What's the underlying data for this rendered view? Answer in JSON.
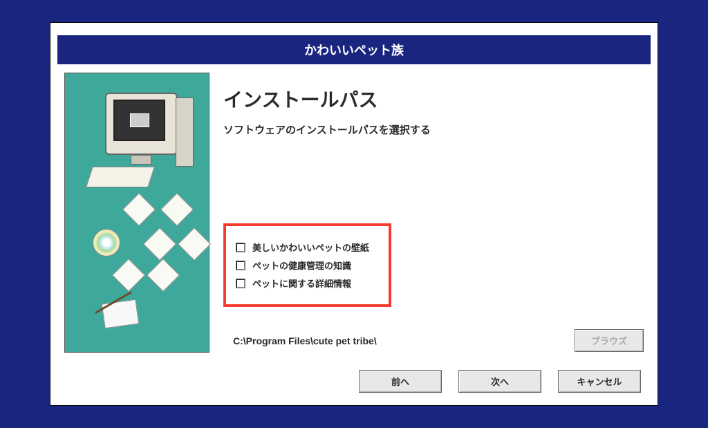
{
  "title": "かわいいペット族",
  "heading": "インストールパス",
  "subheading": "ソフトウェアのインストールパスを選択する",
  "options": [
    {
      "label": "美しいかわいいペットの壁紙",
      "checked": false
    },
    {
      "label": "ペットの健康管理の知識",
      "checked": false
    },
    {
      "label": "ペットに関する詳細情報",
      "checked": false
    }
  ],
  "install_path": "C:\\Program Files\\cute pet tribe\\",
  "buttons": {
    "browse": "ブラウズ",
    "back": "前へ",
    "next": "次へ",
    "cancel": "キャンセル"
  }
}
